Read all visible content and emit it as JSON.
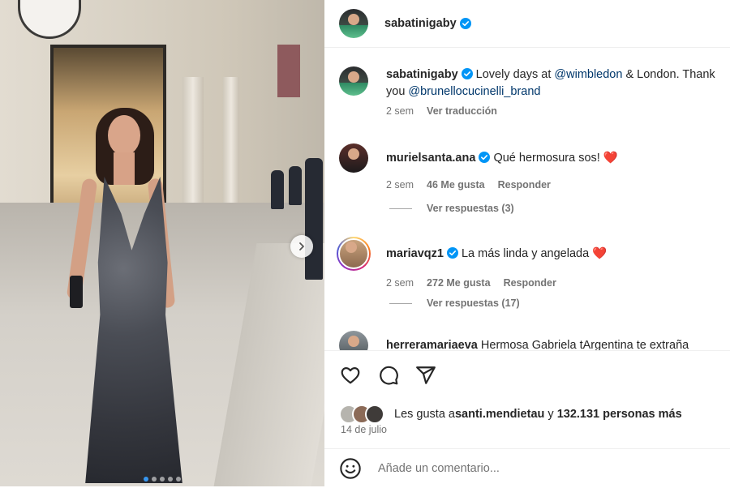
{
  "post": {
    "username": "sabatinigaby",
    "verified": true
  },
  "caption": {
    "username": "sabatinigaby",
    "text_pre": "Lovely days at ",
    "mention_1": "@wimbledon",
    "text_mid": " & London. Thank you ",
    "mention_2": "@brunellocucinelli_brand",
    "time": "2 sem",
    "translate": "Ver traducción"
  },
  "comments": [
    {
      "username": "murielsanta.ana",
      "text": "Qué hermosura sos! ",
      "emoji": "❤️",
      "time": "2 sem",
      "likes": "46 Me gusta",
      "reply": "Responder",
      "view_replies": "Ver respuestas (3)"
    },
    {
      "username": "mariavqz1",
      "text": "La más linda y angelada ",
      "emoji": "❤️",
      "time": "2 sem",
      "likes": "272 Me gusta",
      "reply": "Responder",
      "view_replies": "Ver respuestas (17)"
    },
    {
      "username": "herreramariaeva",
      "text": "Hermosa Gabriela tArgentina te extraña"
    }
  ],
  "likes": {
    "prefix": "Les gusta a ",
    "user": "santi.mendietau",
    "middle": " y ",
    "count": "132.131 personas más"
  },
  "date": "14 de julio",
  "add_comment": {
    "placeholder": "Añade un comentario..."
  },
  "carousel": {
    "total": 5,
    "current": 1
  },
  "colors": {
    "verified": "#0095f6",
    "mention": "#00376b",
    "heart": "#ed4956",
    "meta": "#737373"
  },
  "icons": [
    "heart-icon",
    "comment-icon",
    "share-icon",
    "emoji-icon",
    "chevron-right-icon",
    "verified-badge-icon"
  ]
}
